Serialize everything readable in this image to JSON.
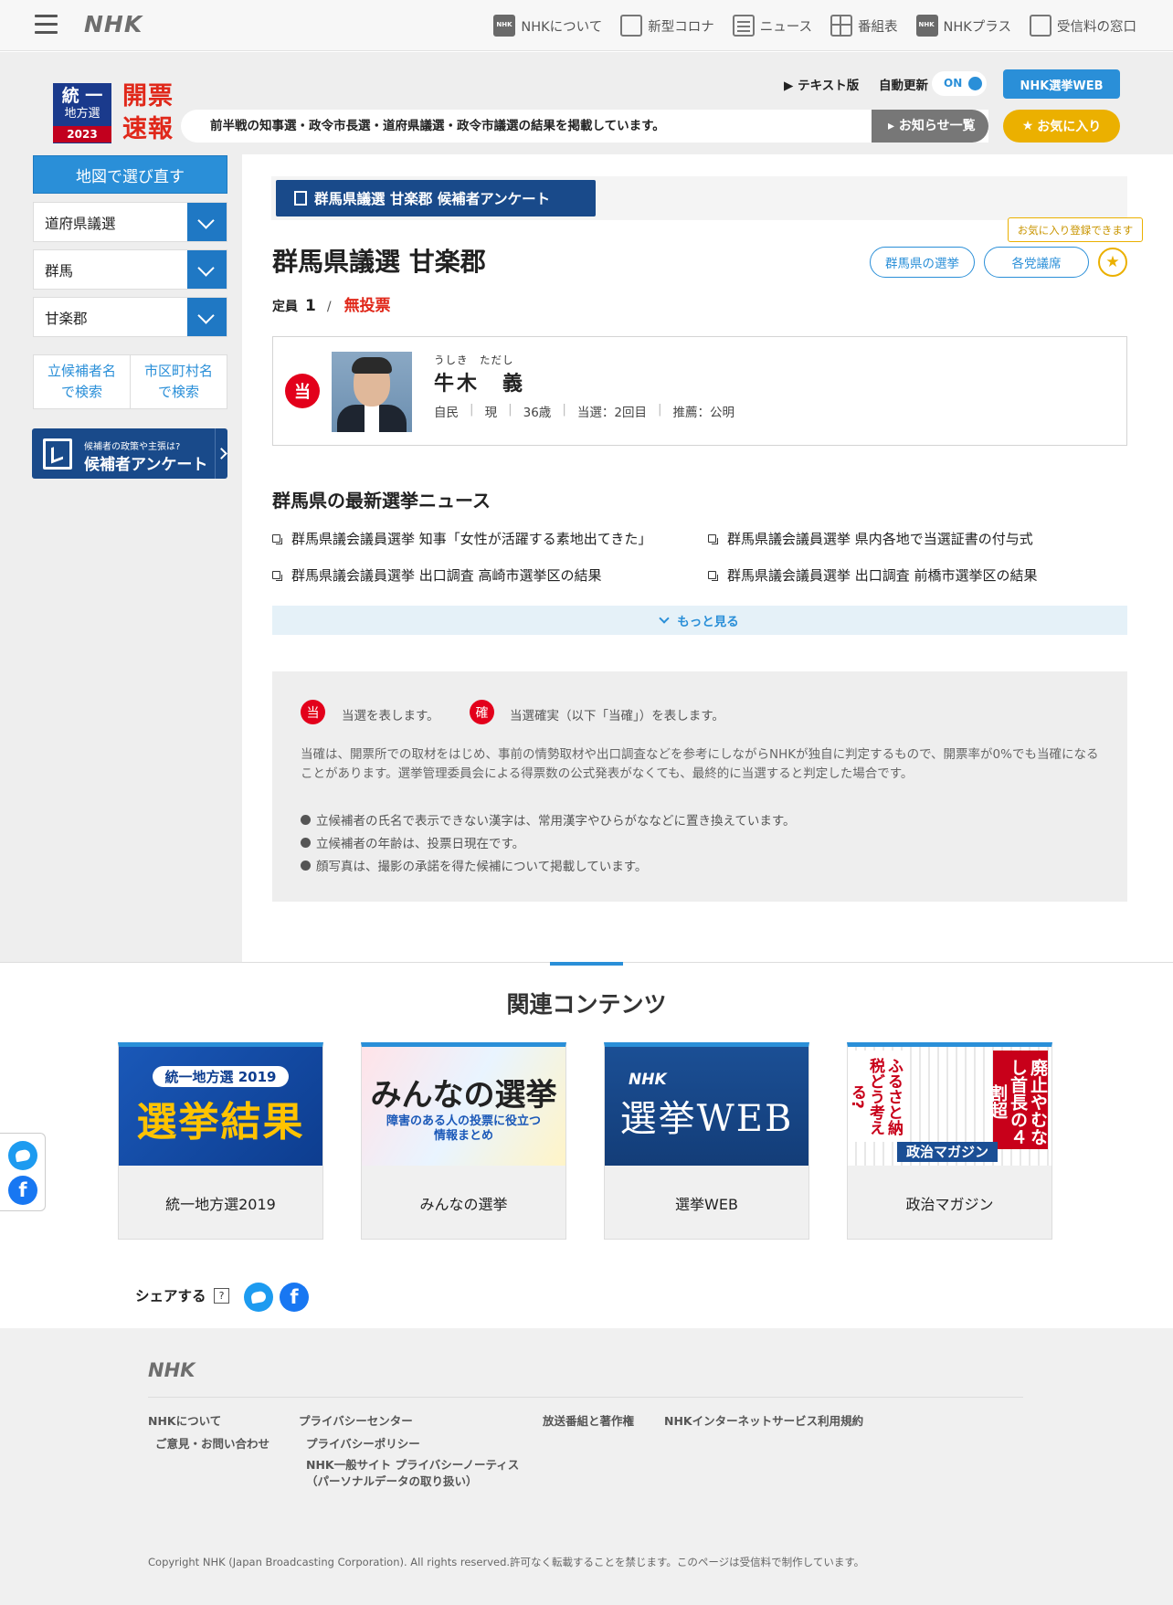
{
  "header": {
    "logo": "NHK",
    "nav": [
      {
        "label": "NHKについて",
        "icon": "nhk-icon"
      },
      {
        "label": "新型コロナ",
        "icon": "corona-icon"
      },
      {
        "label": "ニュース",
        "icon": "news-icon"
      },
      {
        "label": "番組表",
        "icon": "program-table-icon"
      },
      {
        "label": "NHKプラス",
        "icon": "nhk-plus-icon"
      },
      {
        "label": "受信料の窓口",
        "icon": "reception-fee-icon"
      }
    ]
  },
  "election": {
    "badge_line1": "統 一",
    "badge_line2": "地方選",
    "badge_year": "2023",
    "title_line1": "開票",
    "title_line2": "速報",
    "text_version": "テキスト版",
    "auto_update_label": "自動更新",
    "auto_update_state": "ON",
    "web_button": "NHK選挙WEB",
    "notice": "前半戦の知事選・政令市長選・道府県議選・政令市議選の結果を掲載しています。",
    "notice_list_button": "お知らせ一覧",
    "favorite_button": "お気に入り"
  },
  "sidebar": {
    "map_button": "地図で選び直す",
    "selects": [
      "道府県議選",
      "群馬",
      "甘楽郡"
    ],
    "search_candidate": [
      "立候補者名",
      "で検索"
    ],
    "search_city": [
      "市区町村名",
      "で検索"
    ],
    "survey_banner_small": "候補者の政策や主張は?",
    "survey_banner_big": "候補者アンケート"
  },
  "main": {
    "survey_tab": "群馬県議選 甘楽郡 候補者アンケート",
    "title": "群馬県議選 甘楽郡",
    "quota_label": "定員",
    "quota_value": "1",
    "quota_sep": "/",
    "no_vote": "無投票",
    "pref_button": "群馬県の選挙",
    "party_button": "各党議席",
    "favorite_tooltip": "お気に入り登録できます",
    "candidate": {
      "mark": "当",
      "kana": "うしき　ただし",
      "name": "牛木　義",
      "party": "自民",
      "status": "現",
      "age": "36歳",
      "terms": "当選：2回目",
      "recommend": "推薦：公明"
    },
    "news_heading": "群馬県の最新選挙ニュース",
    "news": [
      "群馬県議会議員選挙 知事「女性が活躍する素地出てきた」",
      "群馬県議会議員選挙 県内各地で当選証書の付与式",
      "群馬県議会議員選挙 出口調査 高崎市選挙区の結果",
      "群馬県議会議員選挙 出口調査 前橋市選挙区の結果"
    ],
    "more_button": "もっと見る",
    "legend": {
      "mark1": "当",
      "mark1_text": "当選を表します。",
      "mark2": "確",
      "mark2_text": "当選確実（以下「当確」）を表します。",
      "paragraph": "当確は、開票所での取材をはじめ、事前の情勢取材や出口調査などを参考にしながらNHKが独自に判定するもので、開票率が0%でも当確になることがあります。選挙管理委員会による得票数の公式発表がなくても、最終的に当選すると判定した場合です。",
      "bullets": [
        "立候補者の氏名で表示できない漢字は、常用漢字やひらがななどに置き換えています。",
        "立候補者の年齢は、投票日現在です。",
        "顔写真は、撮影の承諾を得た候補について掲載しています。"
      ]
    }
  },
  "related": {
    "title": "関連コンテンツ",
    "cards": [
      {
        "caption": "統一地方選2019",
        "img_top": "統一地方選 2019",
        "img_main": "選挙結果"
      },
      {
        "caption": "みんなの選挙",
        "img_main": "みんなの選挙",
        "img_sub1": "障害のある人の投票に役立つ",
        "img_sub2": "情報まとめ"
      },
      {
        "caption": "選挙WEB",
        "img_top": "NHK",
        "img_main": "選挙WEB"
      },
      {
        "caption": "政治マガジン",
        "img_red": "廃止やむなし首長の４割超",
        "img_red2": "ふるさと納税どう考える?",
        "img_main": "政治マガジン"
      }
    ]
  },
  "share": {
    "label": "シェアする",
    "help": "?"
  },
  "footer": {
    "logo": "NHK",
    "col1": [
      "NHKについて",
      "ご意見・お問い合わせ"
    ],
    "col2": [
      "プライバシーセンター",
      "プライバシーポリシー",
      "NHK一般サイト プライバシーノーティス",
      "（パーソナルデータの取り扱い）"
    ],
    "col3": [
      "放送番組と著作権"
    ],
    "col4": [
      "NHKインターネットサービス利用規約"
    ],
    "copyright": "Copyright NHK (Japan Broadcasting Corporation). All rights reserved.許可なく転載することを禁じます。このページは受信料で制作しています。"
  },
  "colors": {
    "accent": "#2a8fd8",
    "win_red": "#e3001b",
    "favorite": "#ebb000",
    "navy": "#194a8a"
  }
}
